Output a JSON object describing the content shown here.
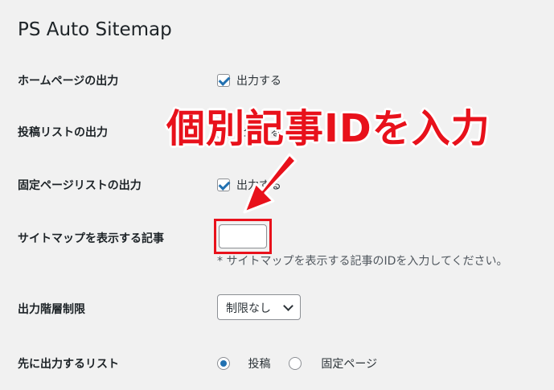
{
  "page": {
    "title": "PS Auto Sitemap"
  },
  "settings": {
    "home_output": {
      "label": "ホームページの出力",
      "checkbox_label": "出力する",
      "checked": true
    },
    "post_list_output": {
      "label": "投稿リストの出力",
      "checkbox_label": "出力する",
      "checked": false
    },
    "page_list_output": {
      "label": "固定ページリストの出力",
      "checkbox_label": "出力する",
      "checked": true
    },
    "sitemap_article": {
      "label": "サイトマップを表示する記事",
      "value": "",
      "description": "* サイトマップを表示する記事のIDを入力してください。"
    },
    "depth_limit": {
      "label": "出力階層制限",
      "selected": "制限なし"
    },
    "first_list": {
      "label": "先に出力するリスト",
      "options": [
        "投稿",
        "固定ページ"
      ],
      "selected": "投稿"
    }
  },
  "annotation": {
    "text": "個別記事IDを入力",
    "color": "#e8111b"
  },
  "colors": {
    "accent": "#2271b1",
    "background": "#f1f1f1",
    "annotation": "#e8111b"
  }
}
